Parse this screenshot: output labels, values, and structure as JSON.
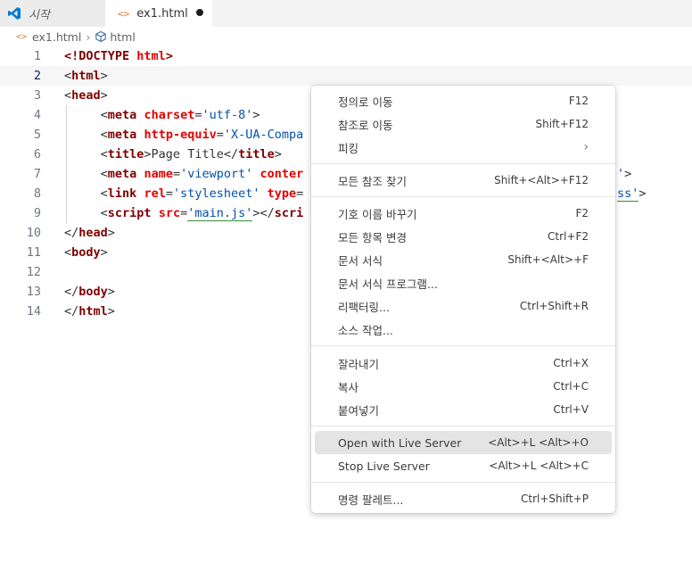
{
  "tabs": [
    {
      "label": "시작",
      "icon": "vscode-icon"
    },
    {
      "label": "ex1.html",
      "icon": "html-file-icon",
      "modified": true
    }
  ],
  "breadcrumb": {
    "file": "ex1.html",
    "symbol": "html"
  },
  "editor": {
    "line_numbers": [
      "1",
      "2",
      "3",
      "4",
      "5",
      "6",
      "7",
      "8",
      "9",
      "10",
      "11",
      "12",
      "13",
      "14"
    ],
    "current_line": "2"
  },
  "menu": {
    "items": [
      {
        "label": "정의로 이동",
        "shortcut": "F12"
      },
      {
        "label": "참조로 이동",
        "shortcut": "Shift+F12"
      },
      {
        "label": "피킹",
        "shortcut": ""
      },
      {
        "label": "모든 참조 찾기",
        "shortcut": "Shift+<Alt>+F12"
      },
      {
        "label": "기호 이름 바꾸기",
        "shortcut": "F2"
      },
      {
        "label": "모든 항목 변경",
        "shortcut": "Ctrl+F2"
      },
      {
        "label": "문서 서식",
        "shortcut": "Shift+<Alt>+F"
      },
      {
        "label": "문서 서식 프로그램...",
        "shortcut": ""
      },
      {
        "label": "리팩터링...",
        "shortcut": "Ctrl+Shift+R"
      },
      {
        "label": "소스 작업...",
        "shortcut": ""
      },
      {
        "label": "잘라내기",
        "shortcut": "Ctrl+X"
      },
      {
        "label": "복사",
        "shortcut": "Ctrl+C"
      },
      {
        "label": "붙여넣기",
        "shortcut": "Ctrl+V"
      },
      {
        "label": "Open with Live Server",
        "shortcut": "<Alt>+L <Alt>+O"
      },
      {
        "label": "Stop Live Server",
        "shortcut": "<Alt>+L <Alt>+C"
      },
      {
        "label": "명령 팔레트...",
        "shortcut": "Ctrl+Shift+P"
      }
    ]
  },
  "colors": {
    "accent": "#007acc",
    "tag": "#800000",
    "attr": "#e50000",
    "string": "#0451a5"
  }
}
